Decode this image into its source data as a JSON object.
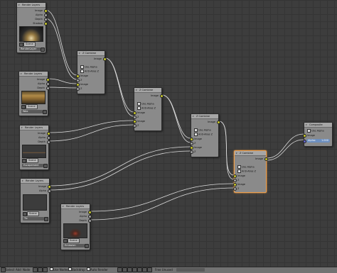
{
  "nodes": {
    "render_layers_1": {
      "title": "Render Layers",
      "outputs": [
        "Image",
        "Alpha",
        "Depth",
        "Shadow"
      ],
      "scene": "Scene",
      "layer": "RenderLayer"
    },
    "render_layers_2": {
      "title": "Render Layers",
      "outputs": [
        "Image",
        "Alpha",
        "Depth"
      ],
      "scene": "Scene",
      "layer": "Wax"
    },
    "render_layers_3": {
      "title": "Render Layers",
      "outputs": [
        "Image",
        "Alpha",
        "Depth"
      ],
      "scene": "Scene",
      "layer": "Escapement"
    },
    "render_layers_4": {
      "title": "Render Layers",
      "outputs": [
        "Image",
        "Alpha"
      ],
      "scene": "Scene",
      "layer": "Tic"
    },
    "render_layers_5": {
      "title": "Render Layers",
      "outputs": [
        "Image",
        "Alpha",
        "Depth"
      ],
      "scene": "Scene",
      "layer": "Emission"
    },
    "z_combine_1": {
      "title": "Z Combine",
      "output": "Image",
      "use_alpha": "Use Alpha",
      "anti_alias": "Anti-Alias Z",
      "inputs": [
        "Image",
        "Z",
        "Image",
        "Z"
      ]
    },
    "z_combine_2": {
      "title": "Z Combine",
      "output": "Image",
      "use_alpha": "Use Alpha",
      "anti_alias": "Anti-Alias Z",
      "inputs": [
        "Image",
        "Z",
        "Image",
        "Z"
      ]
    },
    "z_combine_3": {
      "title": "Z Combine",
      "output": "Image",
      "use_alpha": "Use Alpha",
      "anti_alias": "Anti-Alias Z",
      "inputs": [
        "Image",
        "Z",
        "Image",
        "Z"
      ]
    },
    "z_combine_4": {
      "title": "Z Combine",
      "output": "Image",
      "use_alpha": "Use Alpha",
      "anti_alias": "Anti-Alias Z",
      "inputs": [
        "Image",
        "Z",
        "Image",
        "Z"
      ]
    },
    "composite": {
      "title": "Composite",
      "use_alpha": "Use Alpha",
      "input_image": "Image",
      "alpha_label": "Alpha:",
      "alpha_value": "1.000"
    }
  },
  "statusbar": {
    "menu_select": "Select",
    "menu_add": "Add",
    "menu_node": "Node",
    "use_nodes": "Use Nodes",
    "backdrop": "Backdrop",
    "auto_render": "Auto Render",
    "free_unused": "Free Unused"
  },
  "colors": {
    "canvas": "#3d3d3d",
    "node_body": "#8a8a8a",
    "socket_color": "#c7c729",
    "socket_value": "#a1a1a1",
    "active_border": "#f0a04b",
    "wire": "#dcdcdc"
  },
  "icons": [
    "caret-down-icon",
    "checkbox-icon",
    "image-icon",
    "camera-icon",
    "scene-icon",
    "render-layer-icon"
  ]
}
